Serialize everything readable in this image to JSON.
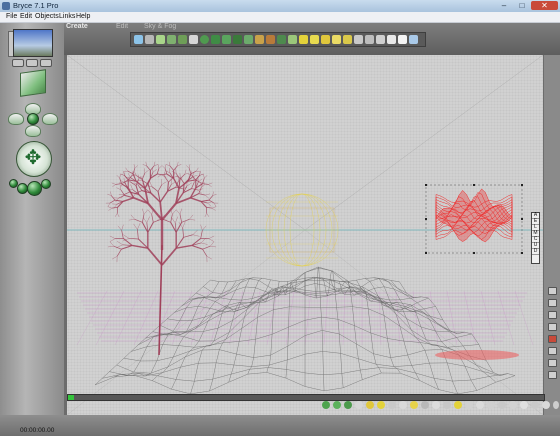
{
  "window": {
    "title": "Bryce 7.1 Pro"
  },
  "menu": [
    "File",
    "Edit",
    "Objects",
    "Links",
    "Help"
  ],
  "palette_tabs": {
    "create": "Create",
    "edit": "Edit",
    "sky_fog": "Sky & Fog"
  },
  "time_readout": "00:00:00.00",
  "selection_tools": [
    "A",
    "E",
    "L",
    "M",
    "C",
    "U",
    "D"
  ],
  "colors": {
    "tree": "#a0405a",
    "terrain": "#6a6a6a",
    "ground_grid": "#c77ac7",
    "light_wire": "#e6d24a",
    "selected_object": "#ef2b2b",
    "horizon": "#66b0b8"
  },
  "icons": {
    "window_controls": [
      "minimize-icon",
      "maximize-icon",
      "close-icon"
    ],
    "left_panel": [
      "nano-preview",
      "camera-cube",
      "trackball",
      "move-cross-icon"
    ]
  }
}
